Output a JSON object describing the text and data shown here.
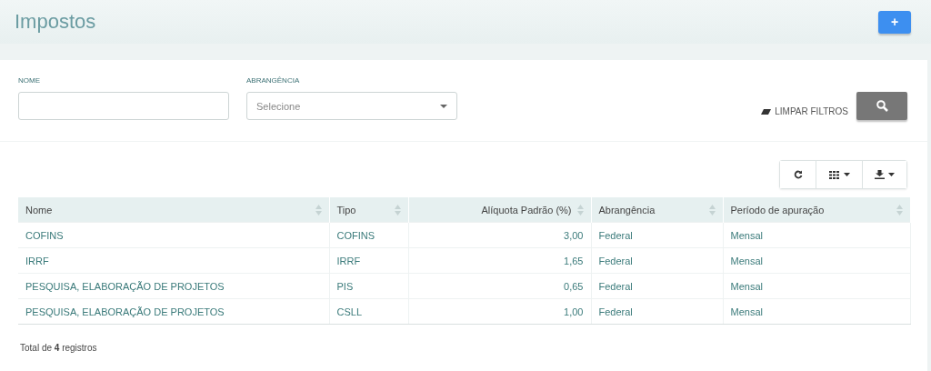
{
  "page": {
    "title": "Impostos",
    "add_button": "+"
  },
  "filters": {
    "fields": [
      {
        "kind": "text",
        "label": "NOME"
      },
      {
        "kind": "select",
        "label": "ABRANGÊNCIA",
        "placeholder": "Selecione"
      }
    ],
    "clear_button": "LIMPAR FILTROS"
  },
  "table": {
    "columns": [
      {
        "label": "Nome",
        "kind": "text"
      },
      {
        "label": "Tipo",
        "kind": "text"
      },
      {
        "label": "Alíquota Padrão (%)",
        "kind": "number"
      },
      {
        "label": "Abrangência",
        "kind": "text"
      },
      {
        "label": "Período de apuração",
        "kind": "text"
      }
    ],
    "rows": [
      [
        "COFINS",
        "COFINS",
        "3,00",
        "Federal",
        "Mensal"
      ],
      [
        "IRRF",
        "IRRF",
        "1,65",
        "Federal",
        "Mensal"
      ],
      [
        "PESQUISA, ELABORAÇÃO DE PROJETOS",
        "PIS",
        "0,65",
        "Federal",
        "Mensal"
      ],
      [
        "PESQUISA, ELABORAÇÃO DE PROJETOS",
        "CSLL",
        "1,00",
        "Federal",
        "Mensal"
      ]
    ]
  },
  "footer": "Total de **4** registros"
}
